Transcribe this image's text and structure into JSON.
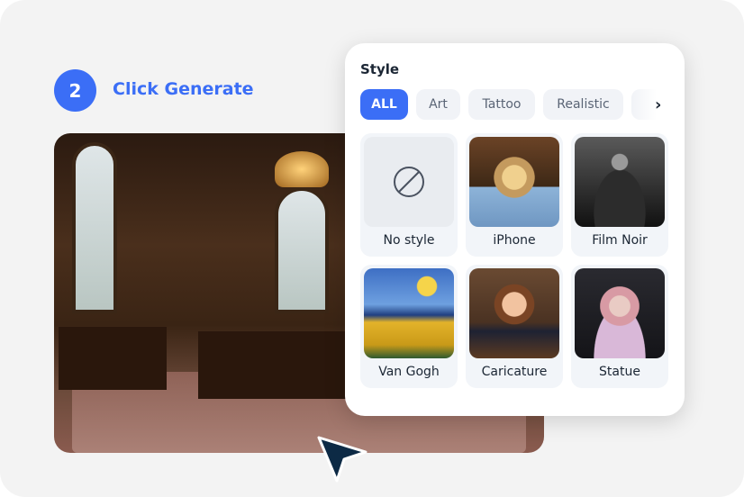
{
  "step": {
    "number": "2",
    "label": "Click Generate",
    "accent": "#3b6ef6"
  },
  "panel": {
    "title": "Style",
    "categories": [
      {
        "label": "ALL",
        "active": true
      },
      {
        "label": "Art",
        "active": false
      },
      {
        "label": "Tattoo",
        "active": false
      },
      {
        "label": "Realistic",
        "active": false
      },
      {
        "label": "P",
        "active": false
      }
    ],
    "styles": [
      {
        "label": "No style",
        "icon": "no-symbol-icon"
      },
      {
        "label": "iPhone"
      },
      {
        "label": "Film Noir"
      },
      {
        "label": "Van Gogh"
      },
      {
        "label": "Caricature"
      },
      {
        "label": "Statue"
      }
    ]
  }
}
